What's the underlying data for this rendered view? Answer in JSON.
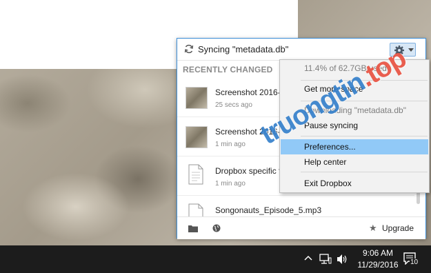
{
  "panel": {
    "sync_status": "Syncing \"metadata.db\"",
    "section_label": "RECENTLY CHANGED",
    "files": [
      {
        "name": "Screenshot 2016-1",
        "time": "25 secs ago",
        "type": "image"
      },
      {
        "name": "Screenshot 2016-1",
        "time": "1 min ago",
        "type": "image"
      },
      {
        "name": "Dropbox specific f",
        "time": "1 min ago",
        "type": "document"
      },
      {
        "name": "Songonauts_Episode_5.mp3",
        "time": "",
        "type": "audio"
      }
    ],
    "footer": {
      "upgrade_label": "Upgrade"
    }
  },
  "menu": {
    "usage": "11.4% of 62.7GB used",
    "get_more_space": "Get more space",
    "downloading": "Downloading \"metadata.db\"",
    "pause_syncing": "Pause syncing",
    "preferences": "Preferences...",
    "help_center": "Help center",
    "exit": "Exit Dropbox"
  },
  "taskbar": {
    "time": "9:06 AM",
    "date": "11/29/2016",
    "notification_count": "10"
  },
  "watermark": {
    "text_main": "truongtin",
    "text_accent": ".top"
  },
  "colors": {
    "accent_blue": "#3b8ed8",
    "menu_highlight": "#91c9f7",
    "taskbar": "#1c1c1c"
  }
}
